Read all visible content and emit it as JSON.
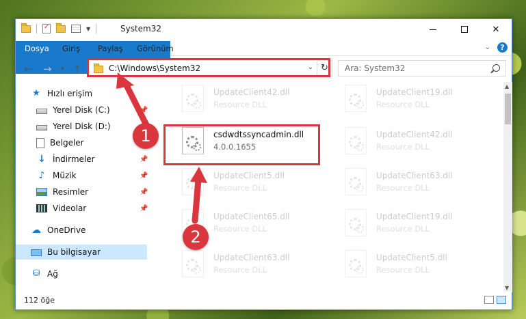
{
  "window": {
    "title": "System32",
    "controls": {
      "minimize": "",
      "maximize": "",
      "close": "✕"
    }
  },
  "ribbon": {
    "tabs": [
      "Dosya",
      "Giriş",
      "Paylaş",
      "Görünüm"
    ],
    "help": "?"
  },
  "nav": {
    "address": "C:\\Windows\\System32",
    "search_placeholder": "Ara: System32"
  },
  "sidebar": {
    "items": [
      {
        "label": "Hızlı erişim",
        "icon": "quick-access-icon"
      },
      {
        "label": "Yerel Disk (C:)",
        "icon": "drive-icon"
      },
      {
        "label": "Yerel Disk (D:)",
        "icon": "drive-icon"
      },
      {
        "label": "Belgeler",
        "icon": "documents-icon"
      },
      {
        "label": "İndirmeler",
        "icon": "downloads-icon"
      },
      {
        "label": "Müzik",
        "icon": "music-icon"
      },
      {
        "label": "Resimler",
        "icon": "pictures-icon"
      },
      {
        "label": "Videolar",
        "icon": "videos-icon"
      },
      {
        "label": "OneDrive",
        "icon": "onedrive-icon"
      },
      {
        "label": "Bu bilgisayar",
        "icon": "this-pc-icon"
      },
      {
        "label": "Ağ",
        "icon": "network-icon"
      }
    ]
  },
  "files": [
    {
      "name": "UpdateClient42.dll",
      "type": "Resource DLL"
    },
    {
      "name": "UpdateClient19.dll",
      "type": "Resource DLL"
    },
    {
      "name": "csdwdtssyncadmin.dll",
      "type": "4.0.0.1655"
    },
    {
      "name": "UpdateClient42.dll",
      "type": "Resource DLL"
    },
    {
      "name": "UpdateClient5.dll",
      "type": "Resource DLL"
    },
    {
      "name": "UpdateClient63.dll",
      "type": "Resource DLL"
    },
    {
      "name": "UpdateClient65.dll",
      "type": "Resource DLL"
    },
    {
      "name": "UpdateClient19.dll",
      "type": "Resource DLL"
    },
    {
      "name": "UpdateClient63.dll",
      "type": "Resource DLL"
    },
    {
      "name": "UpdateClient5.dll",
      "type": "Resource DLL"
    }
  ],
  "status": {
    "count": "112 öğe"
  },
  "callouts": [
    "1",
    "2"
  ],
  "colors": {
    "accent": "#1979ca",
    "highlight": "#d9373d",
    "selected": "#cce8ff"
  }
}
